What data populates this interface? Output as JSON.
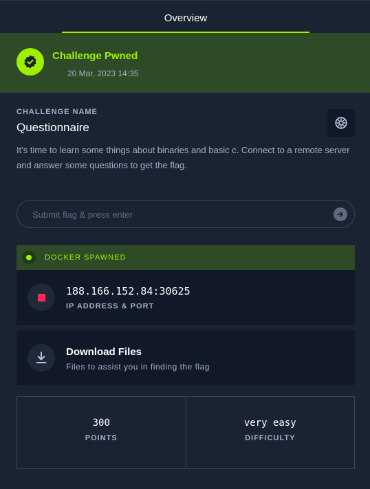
{
  "tabs": [
    {
      "label": "Overview",
      "active": true
    }
  ],
  "pwned": {
    "title": "Challenge Pwned",
    "date": "20 Mar, 2023 14:35",
    "icon": "check-badge-icon",
    "color": "#9fef00"
  },
  "challenge": {
    "section_label": "CHALLENGE NAME",
    "name": "Questionnaire",
    "category_icon": "brain-icon",
    "description": "It's time to learn some things about binaries and basic c. Connect to a remote server and answer some questions to get the flag."
  },
  "flag_input": {
    "placeholder": "Submit flag & press enter",
    "value": ""
  },
  "docker": {
    "status": "DOCKER SPAWNED",
    "ip_port": "188.166.152.84:30625",
    "ip_label": "IP ADDRESS & PORT",
    "stop_color": "#ff2950"
  },
  "download": {
    "title": "Download Files",
    "subtitle": "Files to assist you in finding the flag"
  },
  "stats": {
    "points_value": "300",
    "points_label": "POINTS",
    "difficulty_value": "very easy",
    "difficulty_label": "DIFFICULTY"
  }
}
